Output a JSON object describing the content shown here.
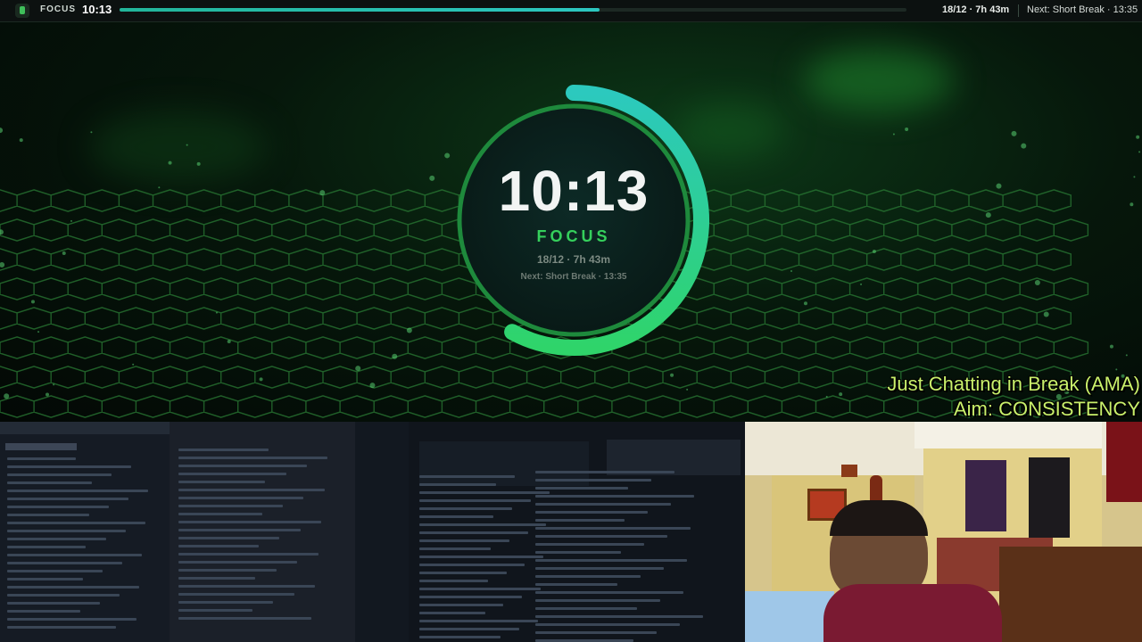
{
  "topbar": {
    "mode": "FOCUS",
    "time": "10:13",
    "progress": 0.61,
    "stats": "18/12 · 7h 43m",
    "next": "Next: Short Break · 13:35"
  },
  "timer": {
    "time": "10:13",
    "mode": "FOCUS",
    "stats": "18/12 · 7h 43m",
    "next": "Next: Short Break · 13:35",
    "ring_progress": 0.58
  },
  "overlay": {
    "line1": "Just Chatting in Break (AMA)",
    "line2": "Aim: CONSISTENCY"
  },
  "colors": {
    "accent_green": "#35d05c",
    "ring_teal": "#22c4b8",
    "overlay_text": "#c9f06b"
  },
  "icons": {
    "app": "focus-timer-icon"
  }
}
